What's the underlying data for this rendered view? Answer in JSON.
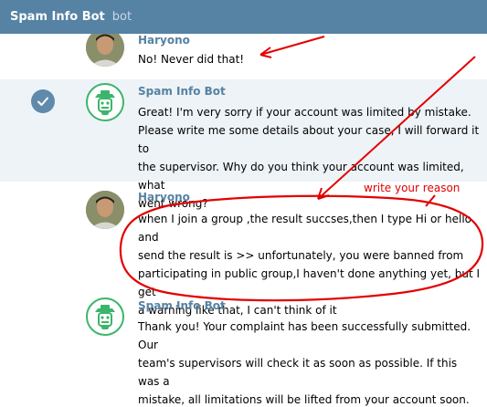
{
  "header": {
    "title": "Spam Info Bot",
    "subtitle": "bot"
  },
  "messages": [
    {
      "sender": "Haryono",
      "text": "No! Never did that!",
      "avatar_icon": "user-photo-avatar",
      "selected": false
    },
    {
      "sender": "Spam Info Bot",
      "text": "Great! I'm very sorry if your account was limited by mistake.\nPlease write me some details about your case, I will forward it to\nthe supervisor. Why do you think your account was limited, what\nwent wrong?",
      "avatar_icon": "bot-avatar",
      "selected": true
    },
    {
      "sender": "Haryono",
      "text": "when I join a group ,the result succses,then I type Hi or hello and\nsend the result is  >>  unfortunately, you were banned from\nparticipating in public group,I haven't done anything yet, but I get\na warning like that, I can't think of it",
      "avatar_icon": "user-photo-avatar",
      "selected": false
    },
    {
      "sender": "Spam Info Bot",
      "text": "Thank you! Your complaint has been successfully submitted. Our\nteam's supervisors will check it as soon as possible. If this was a\nmistake, all limitations will be lifted from your account soon.",
      "avatar_icon": "bot-avatar",
      "selected": false
    }
  ],
  "annotation": {
    "label": "write your reason",
    "color": "#e30000"
  },
  "colors": {
    "header_bg": "#5682a3",
    "sender_name": "#5682a3",
    "selected_row": "#eef3f7",
    "bot_green": "#3bb56c"
  }
}
